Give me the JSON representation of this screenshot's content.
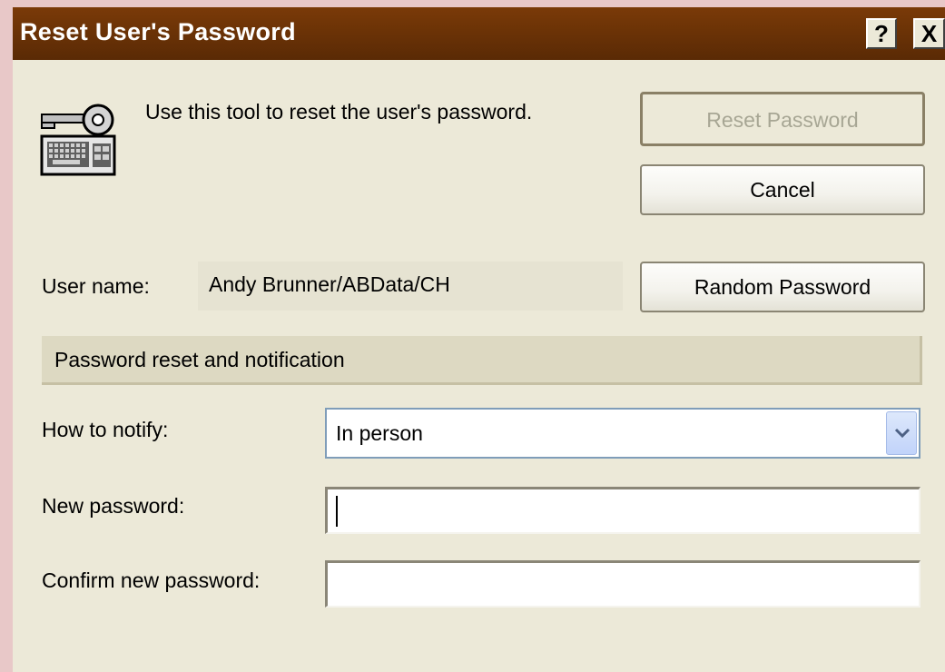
{
  "window": {
    "title": "Reset User's Password",
    "help_glyph": "?",
    "close_glyph": "X"
  },
  "intro": {
    "icon": "key-keyboard-icon",
    "text": "Use this tool to reset the user's password."
  },
  "buttons": {
    "reset_password": "Reset Password",
    "cancel": "Cancel",
    "random_password": "Random Password"
  },
  "user": {
    "label": "User name:",
    "value": "Andy Brunner/ABData/CH"
  },
  "section": {
    "title": "Password reset and notification"
  },
  "form": {
    "notify_label": "How to notify:",
    "notify_value": "In person",
    "new_password_label": "New password:",
    "new_password_value": "",
    "confirm_password_label": "Confirm new password:",
    "confirm_password_value": ""
  },
  "colors": {
    "titlebar": "#6a3206",
    "dialog_bg": "#ece9d8",
    "disabled_text": "#a7a694"
  }
}
